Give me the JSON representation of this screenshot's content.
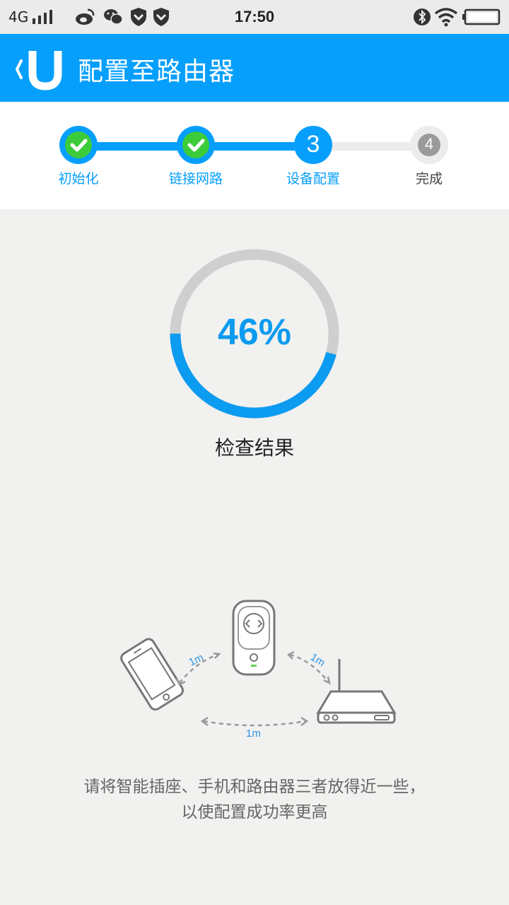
{
  "status_bar": {
    "network": "4G",
    "time": "17:50",
    "icons": [
      "signal-icon",
      "weibo-icon",
      "wechat-icon",
      "shield-icon",
      "shield-icon",
      "bluetooth-icon",
      "wifi-icon",
      "battery-icon"
    ]
  },
  "header": {
    "title": "配置至路由器",
    "logo": "U",
    "background_color": "#069ffc"
  },
  "stepper": {
    "steps": [
      {
        "label": "初始化",
        "state": "done"
      },
      {
        "label": "链接网路",
        "state": "done"
      },
      {
        "label": "设备配置",
        "state": "active",
        "number": "3"
      },
      {
        "label": "完成",
        "state": "pending",
        "number": "4"
      }
    ],
    "colors": {
      "active": "#069ffc",
      "done_check": "#33cc33",
      "pending": "#9a9a9a"
    }
  },
  "progress": {
    "value": "46%",
    "fraction": 0.46,
    "caption": "检查结果"
  },
  "illustration": {
    "distance_labels": [
      "1m",
      "1m",
      "1m"
    ]
  },
  "hint": {
    "line1": "请将智能插座、手机和路由器三者放得近一些，",
    "line2": "以使配置成功率更高"
  }
}
